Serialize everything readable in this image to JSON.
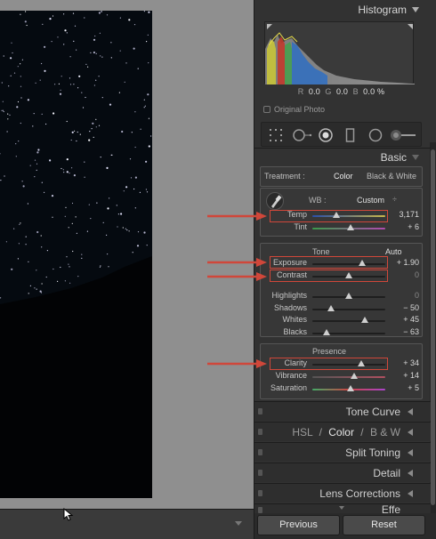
{
  "panel": {
    "histogram": {
      "title": "Histogram",
      "r_label": "R",
      "r_value": "0.0",
      "g_label": "G",
      "g_value": "0.0",
      "b_label": "B",
      "b_value": "0.0",
      "pct": "%",
      "original_photo": "Original Photo"
    },
    "basic": {
      "title": "Basic",
      "treatment_label": "Treatment :",
      "treatment_color": "Color",
      "treatment_bw": "Black & White",
      "wb_label": "WB :",
      "wb_value": "Custom",
      "wb_arrow": "÷",
      "sliders_wb": [
        {
          "label": "Temp",
          "value": "3,171",
          "pos": 0.33
        },
        {
          "label": "Tint",
          "value": "+ 6",
          "pos": 0.53
        }
      ],
      "tone_title": "Tone",
      "auto_label": "Auto",
      "sliders_tone1": [
        {
          "label": "Exposure",
          "value": "+ 1.90",
          "pos": 0.68
        },
        {
          "label": "Contrast",
          "value": "0",
          "pos": 0.5
        }
      ],
      "sliders_tone2": [
        {
          "label": "Highlights",
          "value": "0",
          "pos": 0.5
        },
        {
          "label": "Shadows",
          "value": "− 50",
          "pos": 0.25
        },
        {
          "label": "Whites",
          "value": "+ 45",
          "pos": 0.72
        },
        {
          "label": "Blacks",
          "value": "− 63",
          "pos": 0.19
        }
      ],
      "presence_title": "Presence",
      "sliders_presence": [
        {
          "label": "Clarity",
          "value": "+ 34",
          "pos": 0.67
        },
        {
          "label": "Vibrance",
          "value": "+ 14",
          "pos": 0.57
        },
        {
          "label": "Saturation",
          "value": "+ 5",
          "pos": 0.53
        }
      ]
    },
    "collapsed": {
      "tone_curve": "Tone Curve",
      "hsl": "HSL",
      "color": "Color",
      "bw": "B & W",
      "slash": "/",
      "split_toning": "Split Toning",
      "detail": "Detail",
      "lens_corrections": "Lens Corrections",
      "effects": "Effe"
    },
    "buttons": {
      "previous": "Previous",
      "reset": "Reset"
    }
  }
}
